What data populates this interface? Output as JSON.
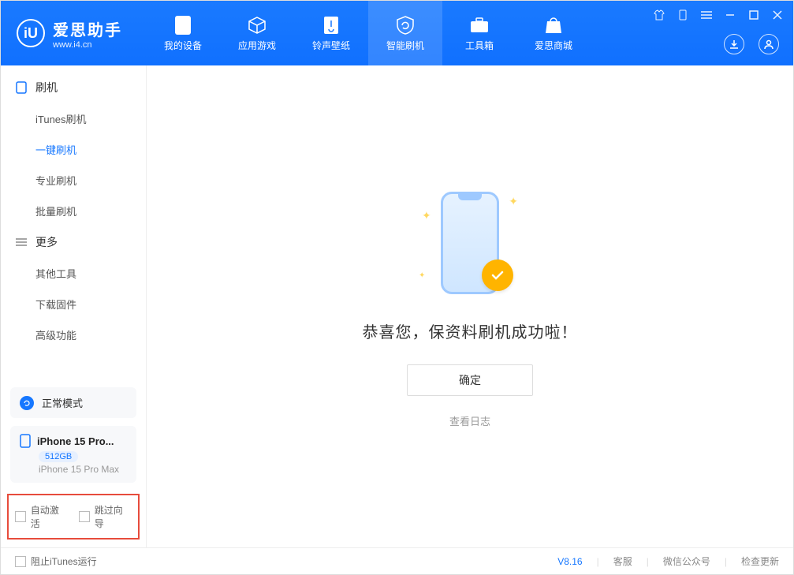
{
  "app": {
    "title": "爱思助手",
    "url": "www.i4.cn"
  },
  "nav": {
    "device": "我的设备",
    "apps": "应用游戏",
    "ringtones": "铃声壁纸",
    "flash": "智能刷机",
    "toolbox": "工具箱",
    "store": "爱思商城"
  },
  "sidebar": {
    "group_flash": "刷机",
    "items_flash": {
      "itunes": "iTunes刷机",
      "oneclick": "一键刷机",
      "pro": "专业刷机",
      "batch": "批量刷机"
    },
    "group_more": "更多",
    "items_more": {
      "other": "其他工具",
      "firmware": "下载固件",
      "advanced": "高级功能"
    },
    "mode": "正常模式",
    "device_name": "iPhone 15 Pro...",
    "device_capacity": "512GB",
    "device_full": "iPhone 15 Pro Max",
    "auto_activate": "自动激活",
    "skip_wizard": "跳过向导"
  },
  "main": {
    "success_text": "恭喜您，保资料刷机成功啦！",
    "ok": "确定",
    "view_log": "查看日志"
  },
  "footer": {
    "block_itunes": "阻止iTunes运行",
    "version": "V8.16",
    "support": "客服",
    "wechat": "微信公众号",
    "update": "检查更新"
  }
}
